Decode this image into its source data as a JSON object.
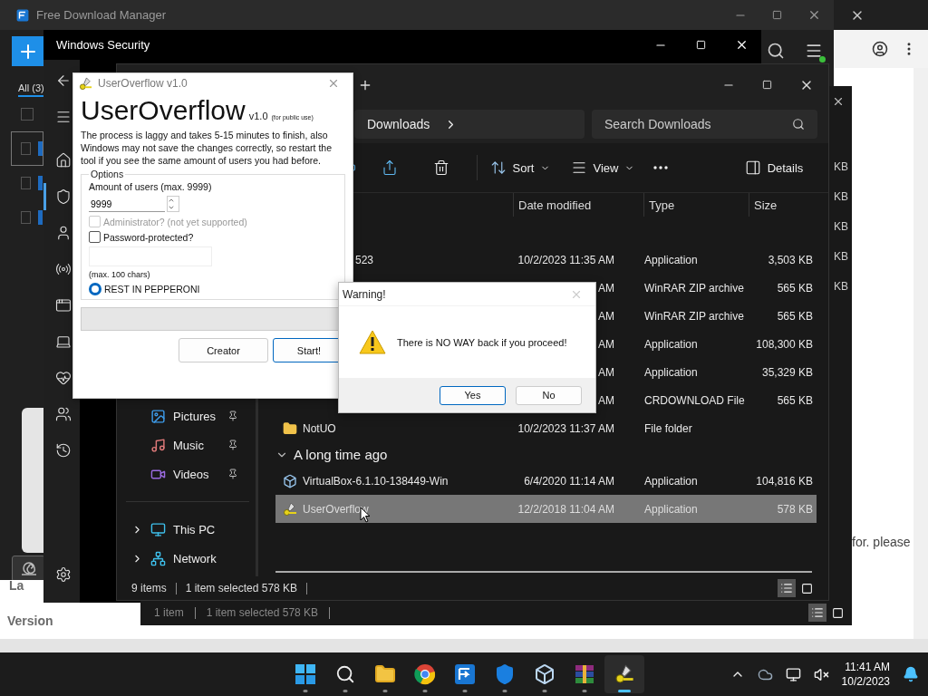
{
  "browser": {
    "corner_text": "La",
    "footer_label": "Version",
    "side_text": "for. please"
  },
  "fdm": {
    "title": "Free Download Manager",
    "filter_tab": "All (3)",
    "rows": [
      {
        "checked": false,
        "selected": false
      },
      {
        "checked": false,
        "selected": true
      },
      {
        "checked": false,
        "selected": false
      },
      {
        "checked": false,
        "selected": false
      }
    ]
  },
  "security": {
    "title": "Windows Security",
    "nav": [
      {
        "kind": "back",
        "selected": false
      },
      {
        "kind": "menu",
        "selected": false
      },
      {
        "kind": "home",
        "selected": false
      },
      {
        "kind": "shield",
        "selected": true
      },
      {
        "kind": "person",
        "selected": false
      },
      {
        "kind": "wifi",
        "selected": false
      },
      {
        "kind": "browser",
        "selected": false
      },
      {
        "kind": "laptop",
        "selected": false
      },
      {
        "kind": "health",
        "selected": false
      },
      {
        "kind": "family",
        "selected": false
      },
      {
        "kind": "history",
        "selected": false
      },
      {
        "kind": "settings",
        "selected": false
      }
    ]
  },
  "back_explorer": {
    "sizes": [
      "KB",
      "KB",
      "KB",
      "KB",
      "KB"
    ],
    "status_count": "1 item",
    "status_selection": "1 item selected  578 KB"
  },
  "explorer": {
    "location": "Downloads",
    "search": {
      "placeholder": "Search Downloads"
    },
    "toolbar": [
      {
        "kind": "rename"
      },
      {
        "kind": "share"
      },
      {
        "kind": "delete"
      },
      {
        "kind": "sort",
        "label": "Sort"
      },
      {
        "kind": "view",
        "label": "View"
      },
      {
        "kind": "more"
      },
      {
        "kind": "details",
        "label": "Details"
      }
    ],
    "columns": [
      "Date modified",
      "Type",
      "Size"
    ],
    "nav": [
      {
        "kind": "pictures",
        "label": "Pictures",
        "pinned": true
      },
      {
        "kind": "music",
        "label": "Music",
        "pinned": true
      },
      {
        "kind": "videos",
        "label": "Videos",
        "pinned": true
      },
      {
        "kind": "pc",
        "label": "This PC",
        "expanded": false
      },
      {
        "kind": "network",
        "label": "Network",
        "expanded": false
      }
    ],
    "groups": [
      {
        "rows": [
          {
            "name": "523",
            "date": "10/2/2023 11:35 AM",
            "type": "Application",
            "size": "3,503 KB",
            "selected": false
          },
          {
            "date": "AM",
            "type": "WinRAR ZIP archive",
            "size": "565 KB",
            "selected": false
          },
          {
            "date": "AM",
            "type": "WinRAR ZIP archive",
            "size": "565 KB",
            "selected": false
          },
          {
            "date": "AM",
            "type": "Application",
            "size": "108,300 KB",
            "selected": false
          },
          {
            "date": "AM",
            "type": "Application",
            "size": "35,329 KB",
            "selected": false
          },
          {
            "date": "AM",
            "type": "CRDOWNLOAD File",
            "size": "565 KB",
            "selected": false
          },
          {
            "kind": "folder",
            "name": "NotUO",
            "date": "10/2/2023 11:37 AM",
            "type": "File folder",
            "selected": false
          }
        ]
      },
      {
        "label": "A long time ago",
        "expanded": true,
        "rows": [
          {
            "kind": "cube",
            "name": "VirtualBox-6.1.10-138449-Win",
            "date": "6/4/2020 11:14 AM",
            "type": "Application",
            "size": "104,816 KB",
            "selected": false
          },
          {
            "kind": "key",
            "name": "UserOverflow",
            "date": "12/2/2018 11:04 AM",
            "type": "Application",
            "size": "578 KB",
            "selected": true
          }
        ]
      }
    ],
    "status": {
      "count": "9 items",
      "selection": "1 item selected  578 KB"
    }
  },
  "app": {
    "title": "UserOverflow v1.0",
    "heading": "UserOverflow",
    "version": "v1.0",
    "note": "(for public use)",
    "description": "The process is laggy and takes 5-15 minutes to finish, also Windows may not save the changes correctly, so restart the tool if you see the same amount of users you had before.",
    "options": {
      "legend": "Options",
      "amount_label": "Amount of users (max. 9999)",
      "amount": "9999",
      "admin": {
        "label": "Administrator? (not yet supported)",
        "checked": false,
        "disabled": true
      },
      "password": {
        "label": "Password-protected?",
        "checked": false,
        "disabled": false
      },
      "password_hint": "(max. 100 chars)",
      "mode": {
        "label": "REST IN PEPPERONI",
        "selected": true
      }
    },
    "progress": {
      "level": 0
    },
    "buttons": [
      {
        "label": "Creator",
        "default": false
      },
      {
        "label": "Start!",
        "default": true
      }
    ]
  },
  "warning": {
    "title": "Warning!",
    "message": "There is NO WAY back if you proceed!",
    "buttons": [
      {
        "label": "Yes",
        "default": true
      },
      {
        "label": "No",
        "default": false
      }
    ]
  },
  "taskbar": {
    "apps": [
      {
        "kind": "start",
        "active": false
      },
      {
        "kind": "search",
        "active": false
      },
      {
        "kind": "folder",
        "active": false
      },
      {
        "kind": "browser",
        "active": false
      },
      {
        "kind": "fdm",
        "active": false
      },
      {
        "kind": "shield",
        "active": false
      },
      {
        "kind": "cube",
        "active": false
      },
      {
        "kind": "archive",
        "active": false
      },
      {
        "kind": "key",
        "active": true
      }
    ],
    "time": "11:41 AM",
    "date": "10/2/2023"
  }
}
